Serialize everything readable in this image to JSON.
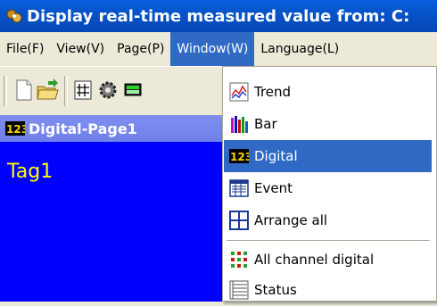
{
  "window": {
    "title": "Display real-time measured value from: C:"
  },
  "menu": {
    "items": [
      "File(F)",
      "View(V)",
      "Page(P)",
      "Window(W)",
      "Language(L)"
    ],
    "active": "Window(W)"
  },
  "toolbar": {
    "icons": [
      "new-file-icon",
      "open-folder-icon",
      "grid-icon",
      "settings-gear-icon",
      "display-icon"
    ]
  },
  "child_window": {
    "title": "Digital-Page1",
    "tag_label": "Tag1"
  },
  "window_menu": {
    "items": [
      {
        "label": "Trend",
        "icon": "trend-icon"
      },
      {
        "label": "Bar",
        "icon": "bar-icon"
      },
      {
        "label": "Digital",
        "icon": "digital-icon",
        "selected": true
      },
      {
        "label": "Event",
        "icon": "event-icon"
      },
      {
        "label": "Arrange all",
        "icon": "arrange-icon"
      },
      {
        "label": "All channel digital",
        "icon": "all-channel-icon"
      },
      {
        "label": "Status",
        "icon": "status-icon"
      }
    ]
  },
  "colors": {
    "accent": "#316ac5",
    "titlebar": "#0653c8",
    "workarea": "#0000ff",
    "tag_text": "#ffff00"
  }
}
